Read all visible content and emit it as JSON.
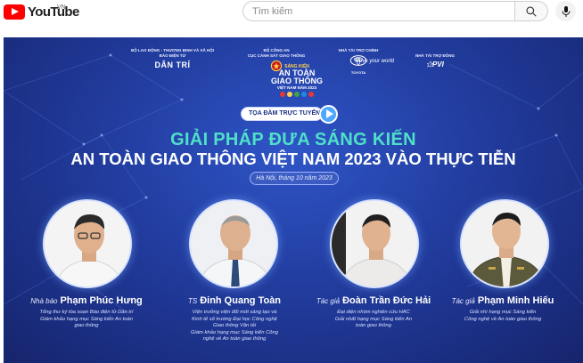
{
  "header": {
    "logo_text": "YouTube",
    "country_code": "VN",
    "search_placeholder": "Tìm kiếm"
  },
  "banner": {
    "sponsors": [
      {
        "caption": "BỘ LAO ĐỘNG - THƯƠNG BINH VÀ XÃ HỘI\nBÁO ĐIỆN TỬ",
        "brand": "DÂN TRÍ"
      },
      {
        "caption": "BỘ CÔNG AN\nCỤC CẢNH SÁT GIAO THÔNG",
        "brand": ""
      },
      {
        "caption": "NHÀ TÀI TRỢ CHÍNH",
        "brand": "TOYOTA"
      },
      {
        "caption": "NHÀ TÀI TRỢ ĐỒNG",
        "brand": "PVI"
      }
    ],
    "event_logo": {
      "small": "SÁNG KIẾN",
      "line1": "AN TOÀN",
      "line2": "GIAO THÔNG",
      "line3": "VIỆT NAM NĂM 2023"
    },
    "toyota_slogan": "Move your world",
    "pill_label": "TỌA ĐÀM TRỰC TUYẾN",
    "title_line1": "GIẢI PHÁP ĐƯA SÁNG KIẾN",
    "title_line2": "AN TOÀN GIAO THÔNG VIỆT NAM 2023 VÀO THỰC TIỄN",
    "date": "Hà Nội, tháng 10 năm 2023",
    "speakers": [
      {
        "role": "Nhà báo",
        "name": "Phạm Phúc Hưng",
        "desc": "Tổng thư ký tòa soạn Báo điện tử Dân trí\nGiám khảo hạng mục Sáng kiến An toàn\ngiao thông"
      },
      {
        "role": "TS",
        "name": "Đinh Quang Toàn",
        "desc": "Viện trưởng viện đổi mới sáng tạo và\nKinh tế số trường Đại học Công nghệ\nGiao thông Vận tải\nGiám khảo hạng mục Sáng kiến Công\nnghệ về An toàn giao thông"
      },
      {
        "role": "Tác giả",
        "name": "Đoàn Trần Đức Hải",
        "desc": "Đại diện nhóm nghiên cứu HAC\nGiải nhất hạng mục Sáng kiến An\ntoàn giao thông"
      },
      {
        "role": "Tác giả",
        "name": "Phạm Minh Hiếu",
        "desc": "Giải nhì hạng mục Sáng kiến\nCông nghệ về An toàn giao thông"
      }
    ]
  }
}
